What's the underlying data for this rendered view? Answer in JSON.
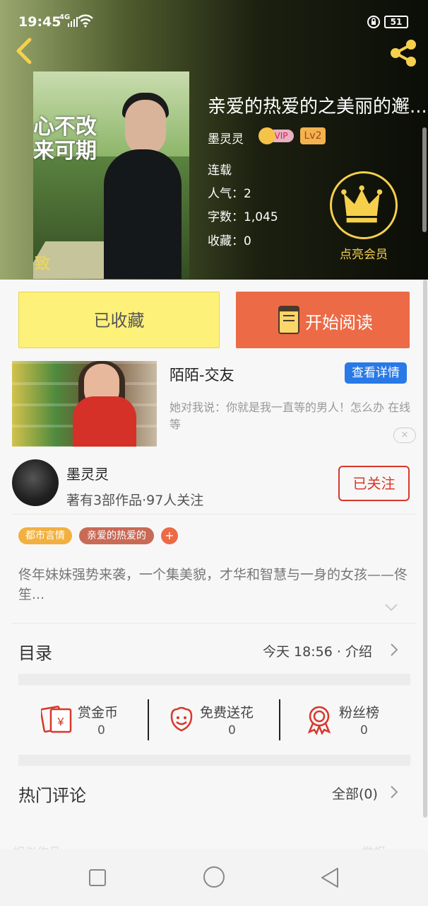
{
  "status": {
    "time": "19:45",
    "network": "4G",
    "battery": "51"
  },
  "book": {
    "title": "亲爱的热爱的之美丽的邂...",
    "author": "墨灵灵",
    "vip_label": "VIP",
    "level": "Lv2",
    "status": "连载",
    "popularity": "人气：2",
    "word_count": "字数：1,045",
    "favorites": "收藏：0",
    "cover_text_line1": "心不改",
    "cover_text_line2": "来可期",
    "cover_mark": "致",
    "member_label": "点亮会员"
  },
  "actions": {
    "favorited": "已收藏",
    "read": "开始阅读"
  },
  "ad": {
    "title": "陌陌-交友",
    "button": "查看详情",
    "desc": "她对我说：你就是我一直等的男人！怎么办 在线等",
    "close": "×"
  },
  "author_card": {
    "name": "墨灵灵",
    "info": "著有3部作品·97人关注",
    "follow": "已关注"
  },
  "tags": [
    {
      "label": "都市言情",
      "color": "#f2b040"
    },
    {
      "label": "亲爱的热爱的",
      "color": "#c86a56"
    },
    {
      "label": "+",
      "color": "#ec6a45"
    }
  ],
  "intro": "佟年妹妹强势来袭，一个集美貌，才华和智慧与一身的女孩——佟笙...",
  "catalog": {
    "label": "目录",
    "info": "今天 18:56 · 介绍"
  },
  "stats": [
    {
      "name": "赏金币",
      "value": "0",
      "icon": "coin-envelope-icon"
    },
    {
      "name": "免费送花",
      "value": "0",
      "icon": "flower-icon"
    },
    {
      "name": "粉丝榜",
      "value": "0",
      "icon": "medal-icon"
    }
  ],
  "comments": {
    "label": "热门评论",
    "all": "全部(0)"
  },
  "bottom_hint": {
    "left": "相似作品",
    "right": "举报"
  },
  "colors": {
    "accent_orange": "#ec6a45",
    "fav_yellow": "#fdf17a",
    "follow_red": "#d9372b",
    "ad_blue": "#2979e6",
    "gold": "#f6d04d"
  }
}
